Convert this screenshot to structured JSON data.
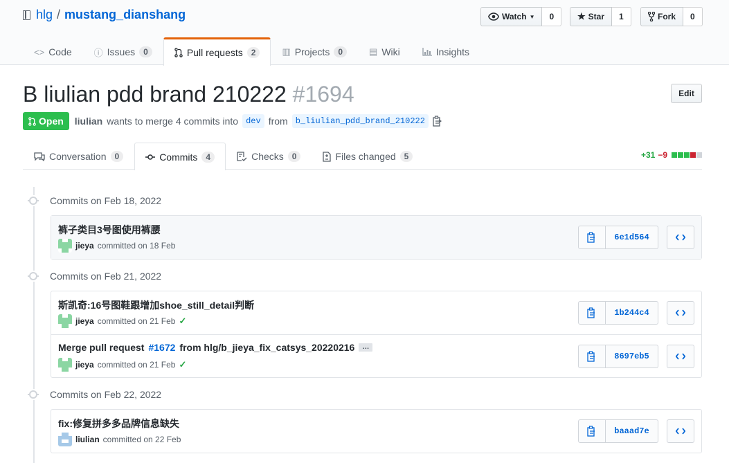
{
  "repo": {
    "owner": "hlg",
    "separator": "/",
    "name": "mustang_dianshang"
  },
  "actions": {
    "watch": {
      "label": "Watch",
      "count": "0"
    },
    "star": {
      "label": "Star",
      "count": "1"
    },
    "fork": {
      "label": "Fork",
      "count": "0"
    }
  },
  "nav": {
    "code": "Code",
    "issues": {
      "label": "Issues",
      "count": "0"
    },
    "pulls": {
      "label": "Pull requests",
      "count": "2"
    },
    "projects": {
      "label": "Projects",
      "count": "0"
    },
    "wiki": "Wiki",
    "insights": "Insights"
  },
  "pr": {
    "title": "B liulian pdd brand 210222",
    "number": "#1694",
    "edit_label": "Edit",
    "state": "Open",
    "author": "liulian",
    "merge_text": "wants to merge 4 commits into",
    "base": "dev",
    "from_text": "from",
    "head": "b_liulian_pdd_brand_210222"
  },
  "tabs": {
    "conversation": {
      "label": "Conversation",
      "count": "0"
    },
    "commits": {
      "label": "Commits",
      "count": "4"
    },
    "checks": {
      "label": "Checks",
      "count": "0"
    },
    "files": {
      "label": "Files changed",
      "count": "5"
    }
  },
  "diffstat": {
    "additions": "+31",
    "deletions": "−9",
    "blocks": [
      "#2cbe4e",
      "#2cbe4e",
      "#2cbe4e",
      "#cb2431",
      "#d1d5da"
    ]
  },
  "groups": [
    {
      "heading": "Commits on Feb 18, 2022",
      "commits": [
        {
          "message": "裤子类目3号图使用裤腰",
          "user": "jieya",
          "committed": "committed on 18 Feb",
          "sha": "6e1d564",
          "check": ""
        }
      ]
    },
    {
      "heading": "Commits on Feb 21, 2022",
      "commits": [
        {
          "message": "斯凯奇:16号图鞋跟增加shoe_still_detail判断",
          "user": "jieya",
          "committed": "committed on 21 Feb",
          "sha": "1b244c4",
          "check": "✓"
        },
        {
          "message_pre": "Merge pull request",
          "message_link": "#1672",
          "message_post": "from hlg/b_jieya_fix_catsys_20220216",
          "ellipsis": "…",
          "user": "jieya",
          "committed": "committed on 21 Feb",
          "sha": "8697eb5",
          "check": "✓"
        }
      ]
    },
    {
      "heading": "Commits on Feb 22, 2022",
      "commits": [
        {
          "message": "fix:修复拼多多品牌信息缺失",
          "user": "liulian",
          "committed": "committed on 22 Feb",
          "sha": "baaad7e",
          "check": ""
        }
      ]
    }
  ]
}
